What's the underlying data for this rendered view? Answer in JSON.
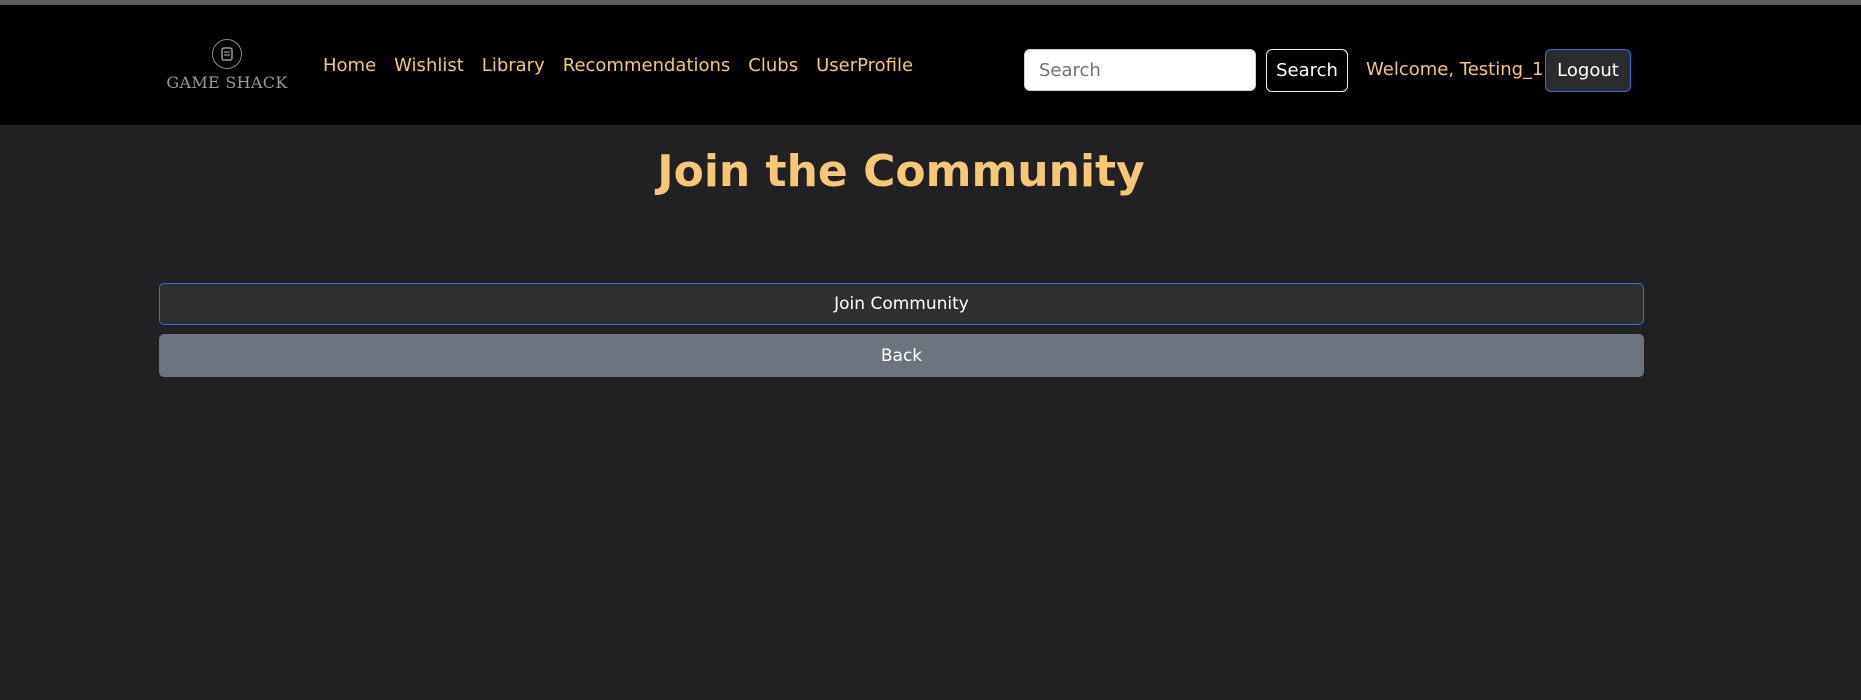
{
  "brand": {
    "logo_text": "GAME SHACK",
    "logo_icon": "controller-badge-icon"
  },
  "nav": {
    "links": [
      "Home",
      "Wishlist",
      "Library",
      "Recommendations",
      "Clubs",
      "UserProfile"
    ]
  },
  "search": {
    "placeholder": "Search",
    "value": "",
    "button_label": "Search"
  },
  "user": {
    "welcome_text": "Welcome, Testing_1!",
    "logout_label": "Logout"
  },
  "main": {
    "title": "Join the Community",
    "join_label": "Join Community",
    "back_label": "Back"
  },
  "colors": {
    "accent": "#f4c877",
    "background": "#212023",
    "navbar": "#000000",
    "primary_border": "#2f6fd6",
    "secondary_button": "#6c757d"
  }
}
